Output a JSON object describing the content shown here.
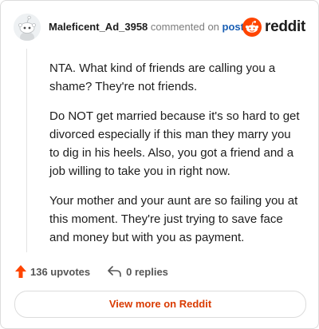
{
  "comment": {
    "username": "Maleficent_Ad_3958",
    "commented_on_text": "commented on",
    "post_link_label": "post",
    "paragraphs": [
      "NTA. What kind of friends are calling you a shame? They're not friends.",
      "Do NOT get married because it's so hard to get divorced especially if this man they marry you to dig in his heels. Also, you got a friend and a job willing to take you in right now.",
      "Your mother and your aunt are so failing you at this moment. They're just trying to save face and money but with you as payment."
    ]
  },
  "brand": {
    "name": "reddit",
    "accent": "#ff4500"
  },
  "actions": {
    "upvotes_label": "136 upvotes",
    "replies_label": "0 replies",
    "upvote_icon": "upvote-arrow-icon",
    "reply_icon": "reply-arrow-icon",
    "upvote_color": "#ff4500"
  },
  "footer": {
    "view_more_label": "View more on Reddit",
    "view_more_color": "#d93a00"
  }
}
